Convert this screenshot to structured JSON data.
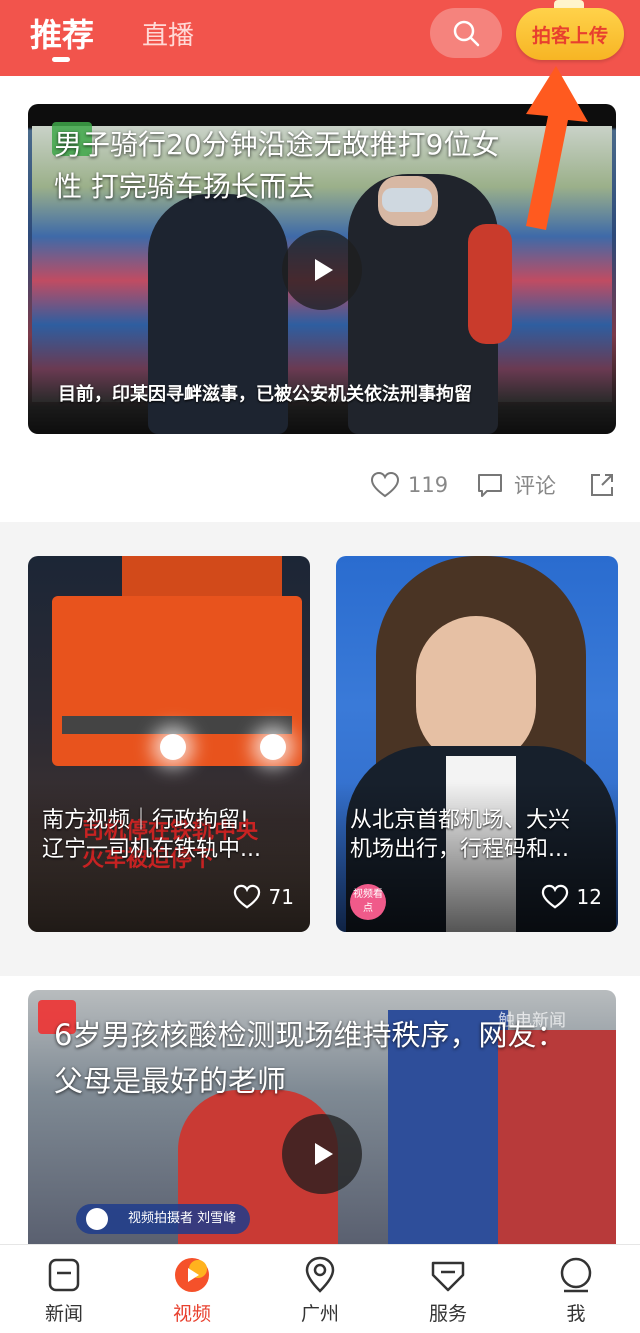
{
  "header": {
    "tab_recommend": "推荐",
    "tab_live": "直播",
    "upload_label": "拍客上传"
  },
  "feed": {
    "card1": {
      "title": "男子骑行20分钟沿途无故推打9位女性 打完骑车扬长而去",
      "subtitle": "目前，印某因寻衅滋事，已被公安机关依法刑事拘留",
      "likes": "119",
      "comment_label": "评论"
    },
    "grid": [
      {
        "caption_line1": "南方视频｜行政拘留!",
        "caption_line2": "辽宁一司机在铁轨中...",
        "overlay": "司机停在铁轨中央火车被迫停下",
        "likes": "71"
      },
      {
        "caption_line1": "从北京首都机场、大兴",
        "caption_line2": "机场出行，行程码和...",
        "badge": "视频看点",
        "likes": "12"
      }
    ],
    "card3": {
      "title": "6岁男孩核酸检测现场维持秩序，网友：父母是最好的老师",
      "credit": "视频拍摄者 刘雪峰",
      "watermark": "触电新闻"
    }
  },
  "nav": [
    {
      "label": "新闻",
      "icon": "news-icon"
    },
    {
      "label": "视频",
      "icon": "video-icon"
    },
    {
      "label": "广州",
      "icon": "location-pin-icon"
    },
    {
      "label": "服务",
      "icon": "service-icon"
    },
    {
      "label": "我",
      "icon": "profile-icon"
    }
  ],
  "colors": {
    "brand_red": "#f2544c",
    "active_tab": "#e8402e",
    "upload_yellow": "#f7b524",
    "arrow_orange": "#ff5a1f"
  }
}
